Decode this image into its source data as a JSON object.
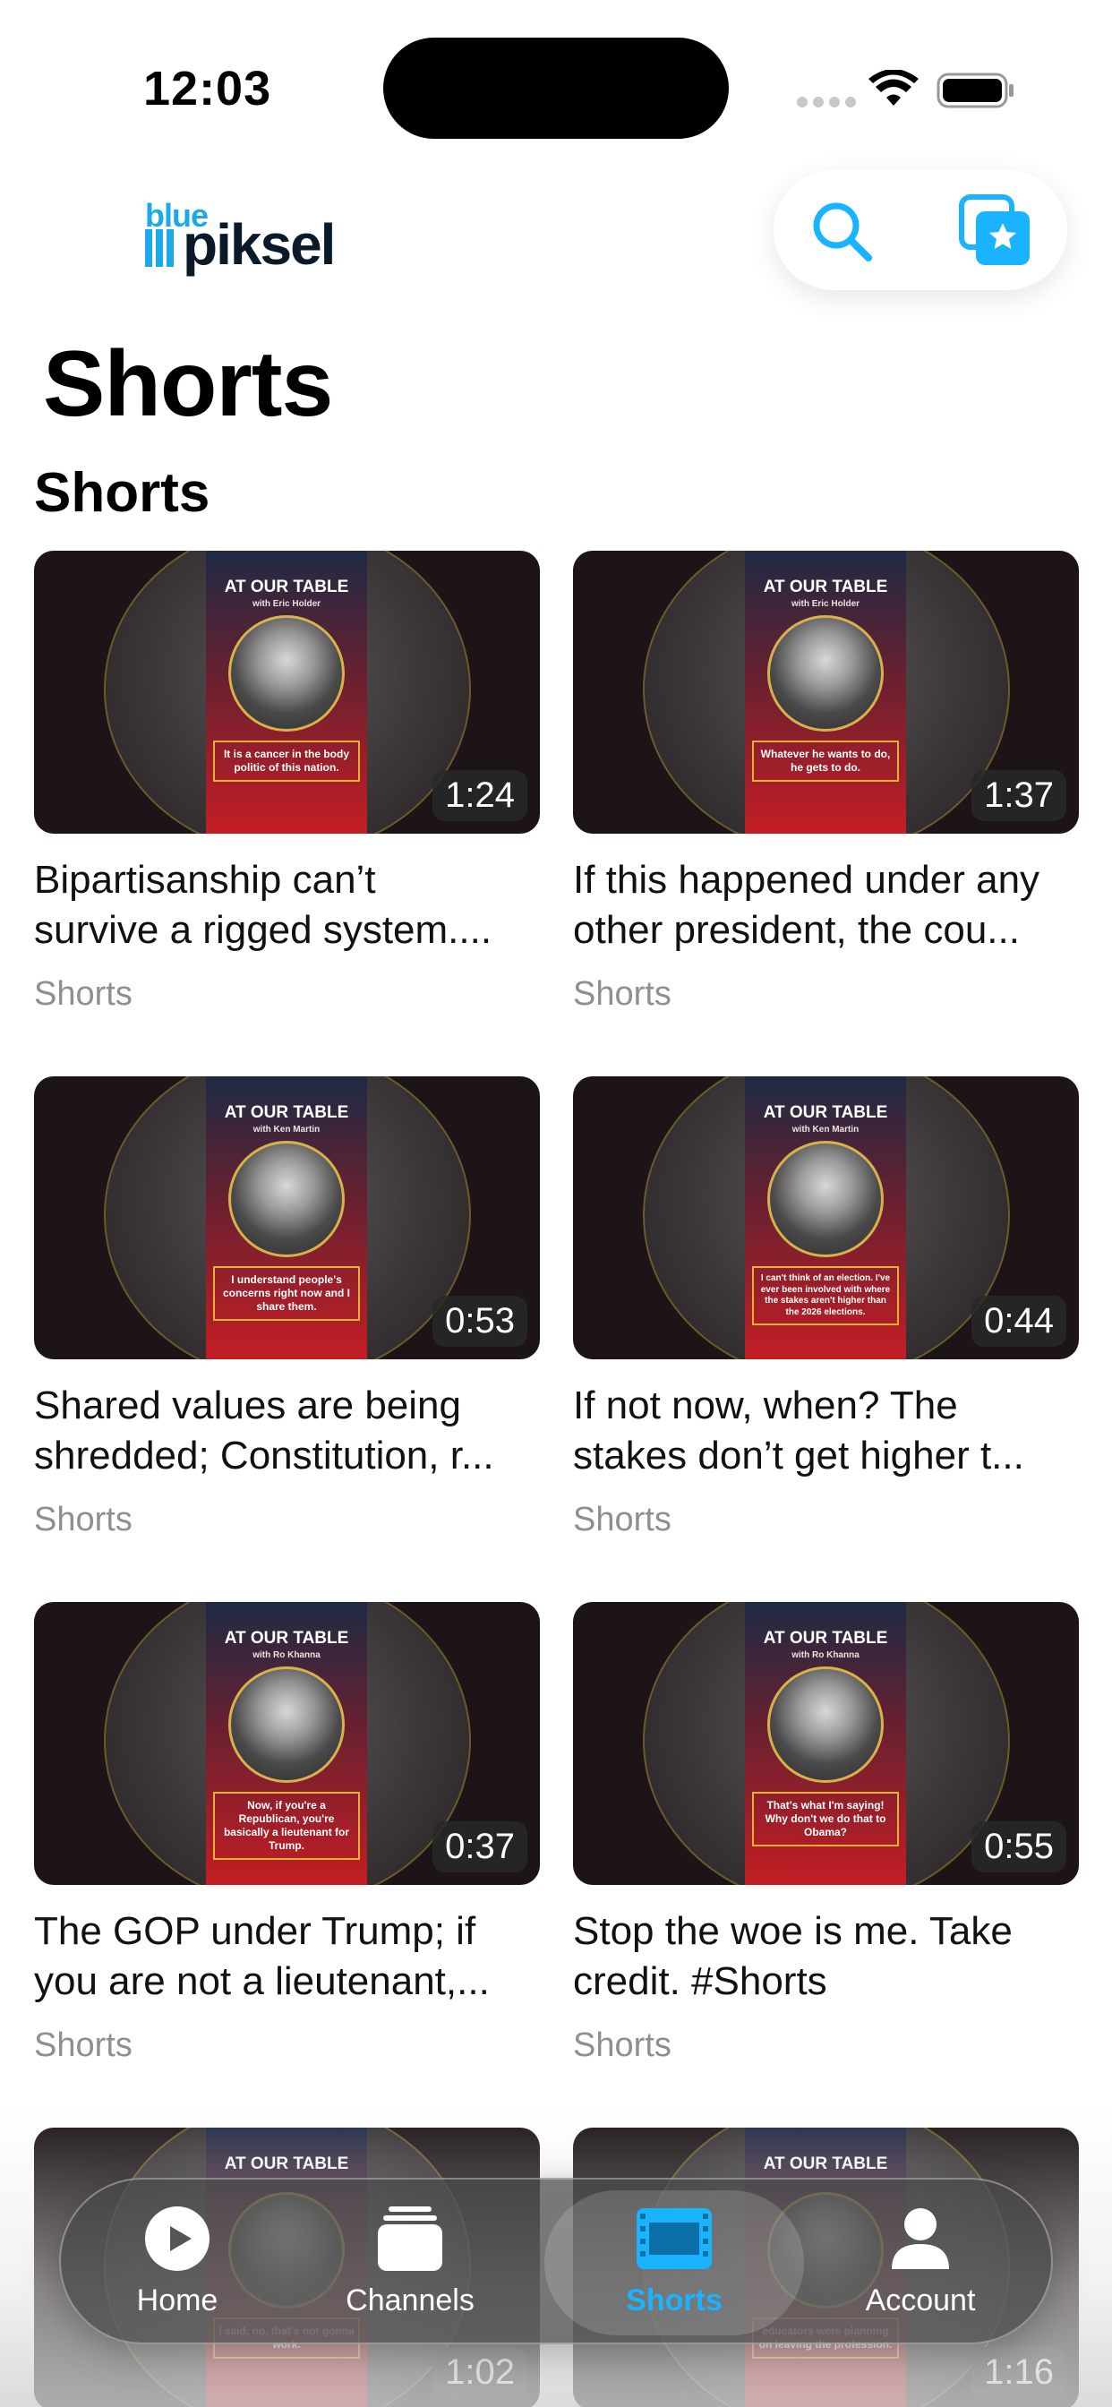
{
  "status_bar": {
    "time": "12:03"
  },
  "header": {
    "logo": {
      "blue": "blue",
      "piksel": "piksel"
    },
    "search_icon": "search-icon",
    "favorites_icon": "star-collection-icon"
  },
  "page": {
    "title": "Shorts",
    "section_title": "Shorts"
  },
  "cards": [
    {
      "poster_title": "AT OUR TABLE",
      "poster_sub": "with Eric Holder",
      "quote": "It is a cancer in the body politic of this nation.",
      "duration": "1:24",
      "title_line1": "Bipartisanship can’t",
      "title_line2": "survive a rigged system....",
      "channel": "Shorts"
    },
    {
      "poster_title": "AT OUR TABLE",
      "poster_sub": "with Eric Holder",
      "quote": "Whatever he wants to do, he gets to do.",
      "duration": "1:37",
      "title_line1": "If this happened under any",
      "title_line2": "other president, the cou...",
      "channel": "Shorts"
    },
    {
      "poster_title": "AT OUR TABLE",
      "poster_sub": "with Ken Martin",
      "quote": "I understand people's concerns right now and I share them.",
      "duration": "0:53",
      "title_line1": "Shared values are being",
      "title_line2": "shredded; Constitution, r...",
      "channel": "Shorts"
    },
    {
      "poster_title": "AT OUR TABLE",
      "poster_sub": "with Ken Martin",
      "quote": "I can't think of an election. I've ever been involved with where the stakes aren't higher than the 2026 elections.",
      "duration": "0:44",
      "title_line1": "If not now, when? The",
      "title_line2": "stakes don’t get higher t...",
      "channel": "Shorts"
    },
    {
      "poster_title": "AT OUR TABLE",
      "poster_sub": "with Ro Khanna",
      "quote": "Now, if you're a Republican, you're basically a lieutenant for Trump.",
      "duration": "0:37",
      "title_line1": "The GOP under Trump; if",
      "title_line2": "you are not a lieutenant,...",
      "channel": "Shorts"
    },
    {
      "poster_title": "AT OUR TABLE",
      "poster_sub": "with Ro Khanna",
      "quote": "That's what I'm saying! Why don't we do that to Obama?",
      "duration": "0:55",
      "title_line1": "Stop the woe is me. Take",
      "title_line2": "credit. #Shorts",
      "channel": "Shorts"
    },
    {
      "poster_title": "AT OUR TABLE",
      "poster_sub": "",
      "quote": "I said, no, that's not gonna work.",
      "duration": "1:02",
      "title_line1": "",
      "title_line2": "",
      "channel": ""
    },
    {
      "poster_title": "AT OUR TABLE",
      "poster_sub": "",
      "quote": "educators were planning on leaving the profession.",
      "duration": "1:16",
      "title_line1": "",
      "title_line2": "",
      "channel": ""
    }
  ],
  "tab_bar": {
    "active": "Shorts",
    "tabs": [
      {
        "label": "Home",
        "icon": "play-circle-icon"
      },
      {
        "label": "Channels",
        "icon": "stack-icon"
      },
      {
        "label": "Shorts",
        "icon": "film-icon"
      },
      {
        "label": "Account",
        "icon": "person-icon"
      }
    ]
  },
  "colors": {
    "accent": "#19b3ff",
    "logo_blue": "#1ba9e8",
    "secondary_text": "#8e8e93"
  }
}
